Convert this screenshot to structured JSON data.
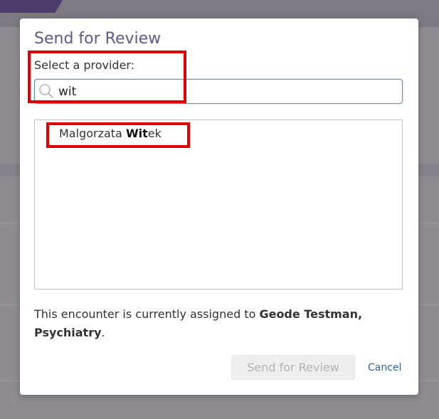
{
  "dialog": {
    "title": "Send for Review",
    "provider_label": "Select a provider:",
    "search": {
      "value": "wit",
      "icon": "search-icon"
    },
    "results": [
      {
        "prefix": "Malgorzata ",
        "match": "Wit",
        "suffix": "ek"
      }
    ],
    "assignment": {
      "prefix": "This encounter is currently assigned to ",
      "assignee": "Geode Testman, Psychiatry",
      "suffix": "."
    },
    "send_button_label": "Send for Review",
    "cancel_label": "Cancel"
  },
  "colors": {
    "title": "#5b5a8c",
    "link": "#2f5fa8",
    "highlight": "#e00000",
    "overlay": "#8e8c91"
  }
}
